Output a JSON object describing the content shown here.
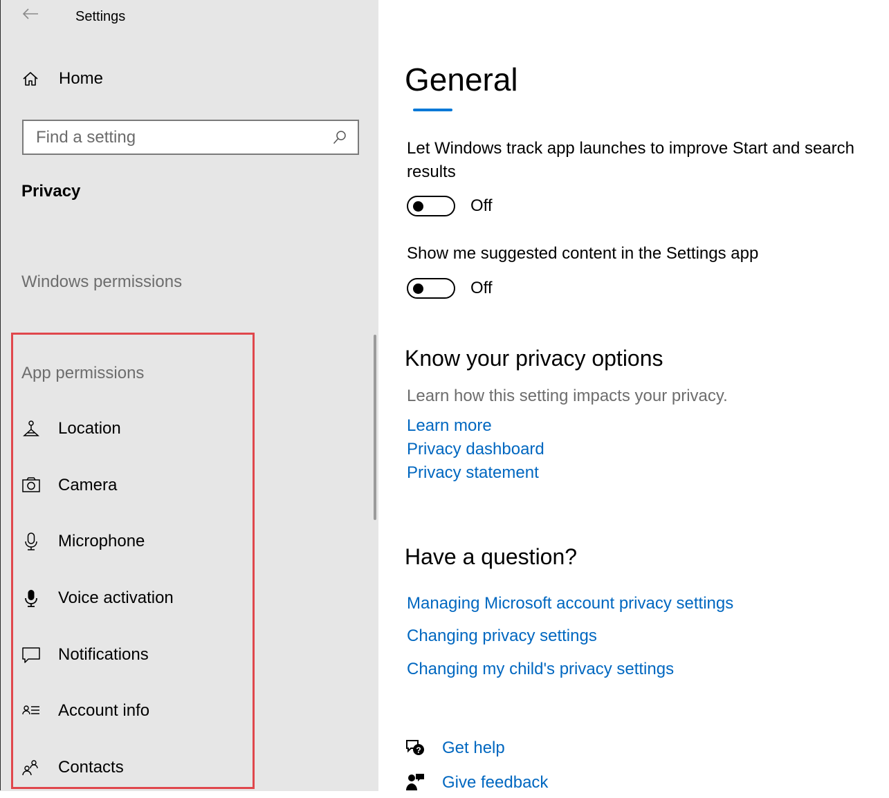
{
  "window": {
    "title": "Settings"
  },
  "sidebar": {
    "home_label": "Home",
    "search_placeholder": "Find a setting",
    "section_title": "Privacy",
    "windows_permissions_label": "Windows permissions",
    "app_permissions_label": "App permissions",
    "items": [
      {
        "label": "Location",
        "icon": "location-icon"
      },
      {
        "label": "Camera",
        "icon": "camera-icon"
      },
      {
        "label": "Microphone",
        "icon": "microphone-icon"
      },
      {
        "label": "Voice activation",
        "icon": "voice-activation-icon"
      },
      {
        "label": "Notifications",
        "icon": "notifications-icon"
      },
      {
        "label": "Account info",
        "icon": "account-info-icon"
      },
      {
        "label": "Contacts",
        "icon": "contacts-icon"
      }
    ]
  },
  "main": {
    "title": "General",
    "settings": [
      {
        "label": "Let Windows track app launches to improve Start and search results",
        "state": "Off"
      },
      {
        "label": "Show me suggested content in the Settings app",
        "state": "Off"
      }
    ],
    "privacy_options": {
      "heading": "Know your privacy options",
      "description": "Learn how this setting impacts your privacy.",
      "links": [
        "Learn more",
        "Privacy dashboard",
        "Privacy statement"
      ]
    },
    "question": {
      "heading": "Have a question?",
      "links": [
        "Managing Microsoft account privacy settings",
        "Changing privacy settings",
        "Changing my child's privacy settings"
      ]
    },
    "help": {
      "get_help": "Get help",
      "give_feedback": "Give feedback"
    }
  },
  "colors": {
    "accent": "#0078d7",
    "link": "#0067c0",
    "sidebar_bg": "#e6e6e6",
    "highlight": "#e0474c"
  }
}
